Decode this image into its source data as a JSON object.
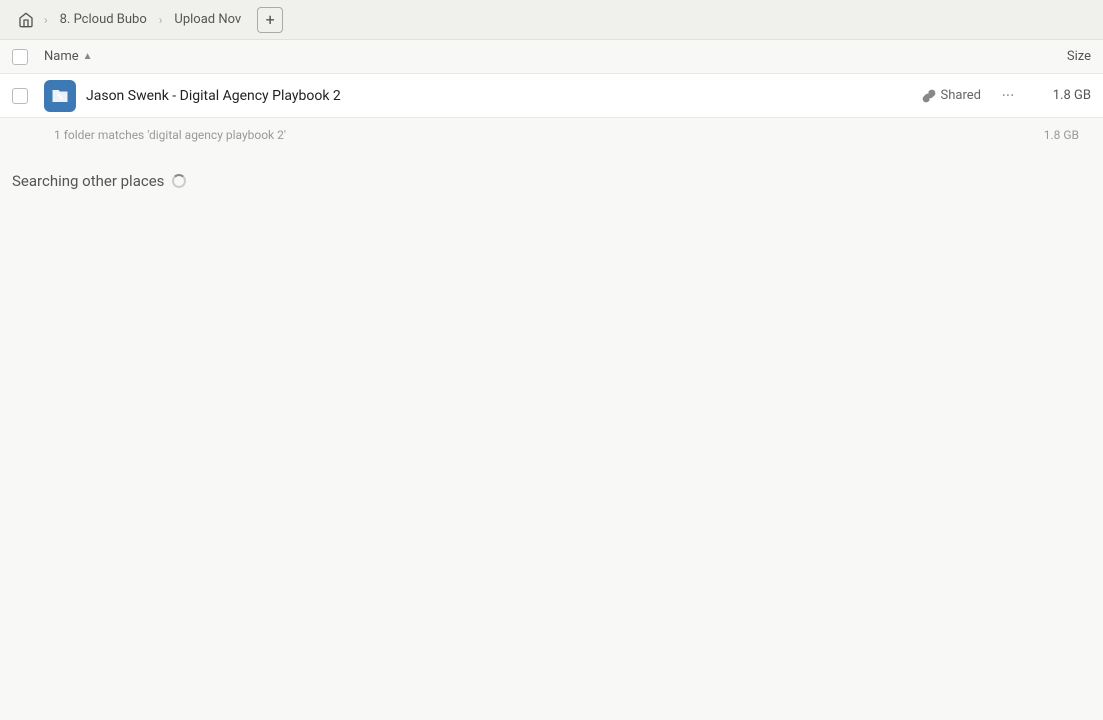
{
  "topbar": {
    "home_icon": "home",
    "breadcrumbs": [
      {
        "label": "8. Pcloud Bubo"
      },
      {
        "label": "Upload Nov"
      }
    ],
    "add_button_label": "+"
  },
  "columns": {
    "name_label": "Name",
    "size_label": "Size"
  },
  "file_row": {
    "name": "Jason Swenk - Digital Agency Playbook 2",
    "shared_label": "Shared",
    "size": "1.8 GB",
    "icon_semantic": "folder-link-icon"
  },
  "match_info": {
    "text": "1 folder matches 'digital agency playbook 2'",
    "size": "1.8 GB"
  },
  "searching": {
    "label": "Searching other places"
  }
}
